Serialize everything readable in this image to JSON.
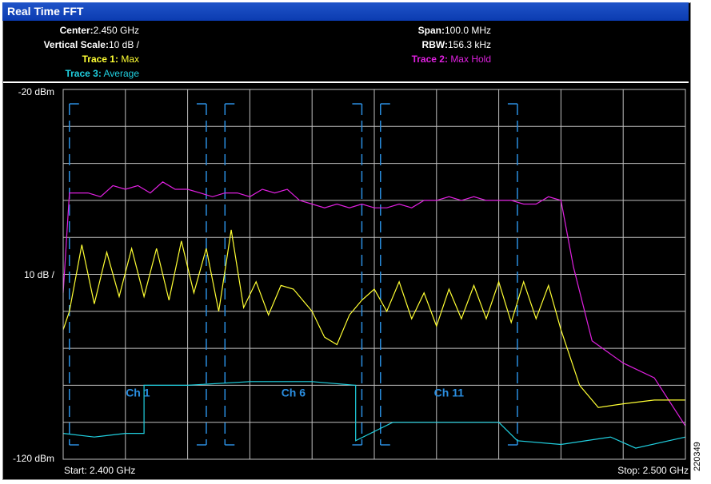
{
  "window": {
    "title": "Real Time FFT"
  },
  "info": {
    "center_label": "Center:",
    "center_value": "2.450 GHz",
    "vscale_label": "Vertical Scale:",
    "vscale_value": "10 dB /",
    "trace1_label": "Trace 1:",
    "trace1_value": "Max",
    "trace3_label": "Trace 3:",
    "trace3_value": "Average",
    "span_label": "Span:",
    "span_value": "100.0 MHz",
    "rbw_label": "RBW:",
    "rbw_value": "156.3 kHz",
    "trace2_label": "Trace 2:",
    "trace2_value": "Max Hold"
  },
  "colors": {
    "trace1": "#ffff33",
    "trace2": "#e020e0",
    "trace3": "#20d0e0",
    "channel": "#2a8ee0",
    "grid": "#c0c0c0",
    "titlebar": "#0b3bb0"
  },
  "watermark": "220349",
  "chart_data": {
    "type": "line",
    "x_unit": "GHz",
    "y_unit": "dBm",
    "xlim": [
      2.4,
      2.5
    ],
    "ylim": [
      -120,
      -20
    ],
    "grid": true,
    "y_top_label": "-20 dBm",
    "y_mid_label": "10 dB /",
    "y_bottom_label": "-120 dBm",
    "x_start_label": "Start: 2.400 GHz",
    "x_stop_label": "Stop: 2.500 GHz",
    "channels": [
      {
        "name": "Ch 1",
        "center": 2.412,
        "low": 2.401,
        "high": 2.423
      },
      {
        "name": "Ch 6",
        "center": 2.437,
        "low": 2.426,
        "high": 2.448
      },
      {
        "name": "Ch 11",
        "center": 2.462,
        "low": 2.451,
        "high": 2.473
      }
    ],
    "series": [
      {
        "name": "Trace 1",
        "legend": "Max",
        "x": [
          2.4,
          2.401,
          2.403,
          2.405,
          2.407,
          2.409,
          2.411,
          2.413,
          2.415,
          2.417,
          2.419,
          2.421,
          2.423,
          2.425,
          2.427,
          2.429,
          2.431,
          2.433,
          2.435,
          2.437,
          2.44,
          2.442,
          2.444,
          2.446,
          2.448,
          2.45,
          2.452,
          2.454,
          2.456,
          2.458,
          2.46,
          2.462,
          2.464,
          2.466,
          2.468,
          2.47,
          2.472,
          2.474,
          2.476,
          2.478,
          2.48,
          2.483,
          2.486,
          2.49,
          2.495,
          2.5
        ],
        "y": [
          -85,
          -80,
          -62,
          -78,
          -64,
          -76,
          -63,
          -76,
          -63,
          -77,
          -61,
          -75,
          -63,
          -80,
          -58,
          -79,
          -72,
          -81,
          -73,
          -74,
          -80,
          -87,
          -89,
          -81,
          -77,
          -74,
          -80,
          -72,
          -82,
          -75,
          -84,
          -74,
          -82,
          -73,
          -82,
          -72,
          -83,
          -72,
          -82,
          -73,
          -85,
          -100,
          -106,
          -105,
          -104,
          -104
        ]
      },
      {
        "name": "Trace 2",
        "legend": "Max Hold",
        "x": [
          2.4,
          2.401,
          2.402,
          2.404,
          2.406,
          2.408,
          2.41,
          2.412,
          2.414,
          2.416,
          2.418,
          2.42,
          2.422,
          2.424,
          2.426,
          2.428,
          2.43,
          2.432,
          2.434,
          2.436,
          2.438,
          2.44,
          2.442,
          2.444,
          2.446,
          2.448,
          2.45,
          2.452,
          2.454,
          2.456,
          2.458,
          2.46,
          2.462,
          2.464,
          2.466,
          2.468,
          2.47,
          2.472,
          2.474,
          2.476,
          2.478,
          2.48,
          2.482,
          2.485,
          2.49,
          2.495,
          2.5
        ],
        "y": [
          -75,
          -48,
          -48,
          -48,
          -49,
          -46,
          -47,
          -46,
          -48,
          -45,
          -47,
          -47,
          -48,
          -49,
          -48,
          -48,
          -49,
          -47,
          -48,
          -47,
          -50,
          -51,
          -52,
          -51,
          -52,
          -51,
          -52,
          -52,
          -51,
          -52,
          -50,
          -50,
          -49,
          -50,
          -49,
          -50,
          -50,
          -50,
          -51,
          -51,
          -49,
          -50,
          -68,
          -88,
          -94,
          -98,
          -111
        ]
      },
      {
        "name": "Trace 3",
        "legend": "Average",
        "x": [
          2.4,
          2.405,
          2.41,
          2.413,
          2.413,
          2.42,
          2.43,
          2.44,
          2.447,
          2.447,
          2.453,
          2.46,
          2.47,
          2.473,
          2.48,
          2.488,
          2.492,
          2.5
        ],
        "y": [
          -113,
          -114,
          -113,
          -113,
          -100,
          -100,
          -99,
          -99,
          -100,
          -115,
          -110,
          -110,
          -110,
          -115,
          -116,
          -114,
          -117,
          -114
        ]
      }
    ]
  }
}
